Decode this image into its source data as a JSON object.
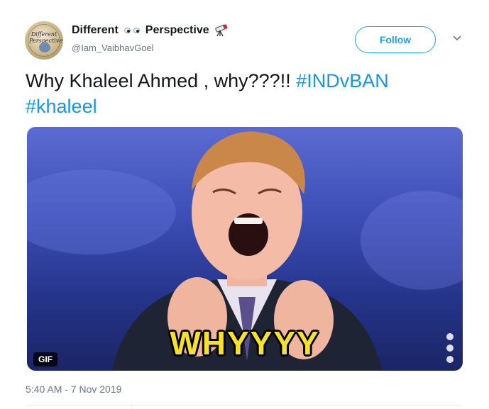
{
  "tweet": {
    "author": {
      "display_name_first": "Different",
      "display_name_second": "Perspective",
      "handle": "@Iam_VaibhavGoel",
      "avatar_text": "Different Perspective",
      "eyes_icon": "eyes-emoji-icon",
      "telescope_icon": "telescope-emoji-icon"
    },
    "follow_label": "Follow",
    "more_icon": "chevron-down-icon",
    "text_plain": "Why Khaleel Ahmed , why???!! ",
    "hashtag_1": "#INDvBAN",
    "hashtag_2": "#khaleel",
    "media": {
      "caption": "WHYYYY",
      "badge": "GIF"
    },
    "timestamp": "5:40 AM - 7 Nov 2019"
  },
  "colors": {
    "link": "#1b95e0",
    "follow": "#1da1f2",
    "muted": "#657786",
    "caption": "#f6e12f"
  }
}
